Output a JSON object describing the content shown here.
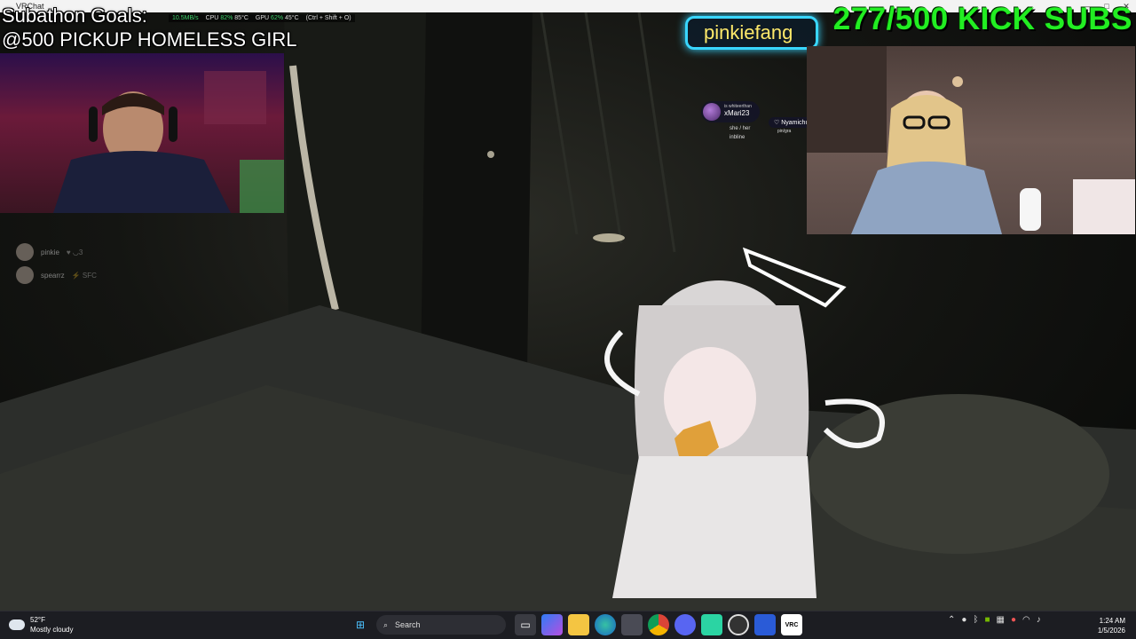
{
  "window": {
    "title": "VRChat",
    "controls": [
      "—",
      "□",
      "✕"
    ]
  },
  "overlay": {
    "subathon_title": "Subathon Goals:",
    "subathon_goal": "@500 PICKUP HOMELESS GIRL",
    "subs_counter": "277/500 KICK SUBS",
    "neon_sign_text": "pinkiefang",
    "perf": {
      "net": "10.5MB/s",
      "cpu_label": "CPU",
      "cpu_load": "82%",
      "cpu_temp": "85°C",
      "gpu_label": "GPU",
      "gpu_load": "62%",
      "gpu_temp": "45°C",
      "hotkey": "(Ctrl + Shift + O)"
    }
  },
  "voice_list": [
    {
      "name": "pinkie",
      "tag": "♥ ◡3"
    },
    {
      "name": "spearrz",
      "tag": "⚡ SFC"
    }
  ],
  "nameplates": {
    "main_top": "is whiteerthan",
    "main_name": "xMari23",
    "main_sub1": "she / her",
    "main_sub2": "inbline",
    "second_name": "♡ Nyamichu",
    "second_sub": "pin/gra"
  },
  "taskbar": {
    "weather_temp": "52°F",
    "weather_desc": "Mostly cloudy",
    "search_placeholder": "Search",
    "time": "1:24 AM",
    "date": "1/5/2026",
    "app_icons": [
      "windows-start-icon",
      "task-view-icon",
      "copilot-icon",
      "file-explorer-icon",
      "edge-icon",
      "store-icon",
      "chrome-icon",
      "discord-icon",
      "game-icon",
      "obs-icon",
      "app-icon",
      "vrchat-icon"
    ]
  },
  "colors": {
    "subs_green": "#22ee22",
    "neon_blue": "#39d6ff",
    "taskbar_bg": "#1c1d22"
  }
}
